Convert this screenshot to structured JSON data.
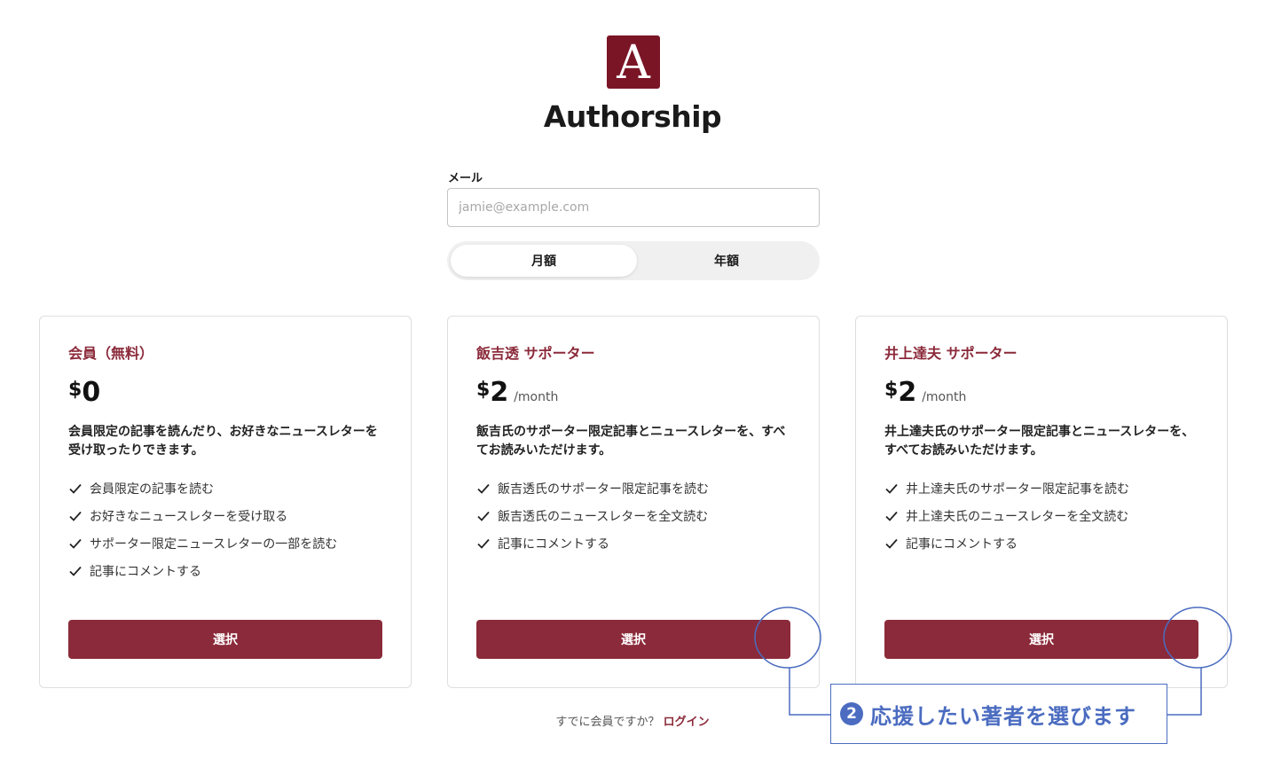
{
  "brand": {
    "logo_letter": "A",
    "name": "Authorship",
    "color": "#7a1526"
  },
  "email": {
    "label": "メール",
    "placeholder": "jamie@example.com",
    "value": ""
  },
  "billing_toggle": {
    "monthly": "月額",
    "yearly": "年額",
    "selected": "monthly"
  },
  "plans": [
    {
      "title": "会員（無料）",
      "currency": "$",
      "amount": "0",
      "period": "",
      "description": "会員限定の記事を読んだり、お好きなニュースレターを受け取ったりできます。",
      "features": [
        "会員限定の記事を読む",
        "お好きなニュースレターを受け取る",
        "サポーター限定ニュースレターの一部を読む",
        "記事にコメントする"
      ],
      "button": "選択"
    },
    {
      "title": "飯吉透 サポーター",
      "currency": "$",
      "amount": "2",
      "period": "/month",
      "description": "飯吉氏のサポーター限定記事とニュースレターを、すべてお読みいただけます。",
      "features": [
        "飯吉透氏のサポーター限定記事を読む",
        "飯吉透氏のニュースレターを全文読む",
        "記事にコメントする"
      ],
      "button": "選択"
    },
    {
      "title": "井上達夫 サポーター",
      "currency": "$",
      "amount": "2",
      "period": "/month",
      "description": "井上達夫氏のサポーター限定記事とニュースレターを、すべてお読みいただけます。",
      "features": [
        "井上達夫氏のサポーター限定記事を読む",
        "井上達夫氏のニュースレターを全文読む",
        "記事にコメントする"
      ],
      "button": "選択"
    }
  ],
  "footer": {
    "prompt": "すでに会員ですか？",
    "login": "ログイン"
  },
  "annotation": {
    "number": "2",
    "text": "応援したい著者を選びます",
    "color": "#4b6cc0"
  },
  "colors": {
    "accent": "#8b2a3a",
    "card_border": "#dedede"
  }
}
